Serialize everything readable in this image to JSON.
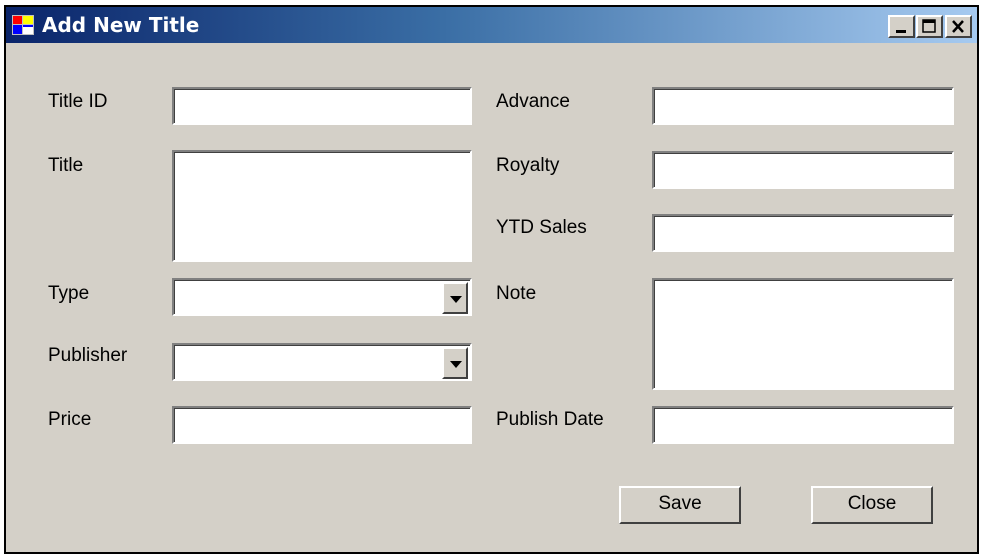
{
  "window": {
    "title": "Add New Title",
    "minimize_label": "_",
    "maximize_label": "□",
    "close_label": "X"
  },
  "form": {
    "title_id_label": "Title ID",
    "title_label": "Title",
    "type_label": "Type",
    "publisher_label": "Publisher",
    "price_label": "Price",
    "advance_label": "Advance",
    "royalty_label": "Royalty",
    "ytd_sales_label": "YTD Sales",
    "note_label": "Note",
    "publish_date_label": "Publish Date",
    "title_id_value": "",
    "title_value": "",
    "type_value": "",
    "publisher_value": "",
    "price_value": "",
    "advance_value": "",
    "royalty_value": "",
    "ytd_sales_value": "",
    "note_value": "",
    "publish_date_value": ""
  },
  "buttons": {
    "save_label": "Save",
    "close_label": "Close"
  }
}
